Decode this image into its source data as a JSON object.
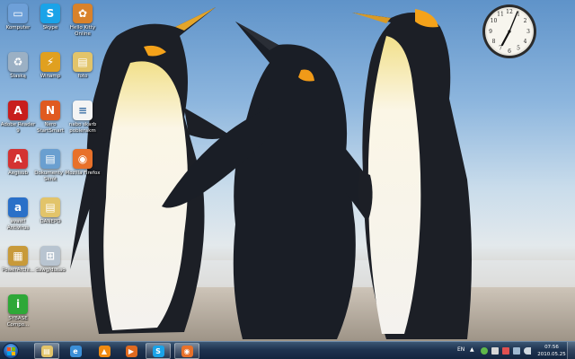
{
  "desktop": {
    "icons": [
      {
        "label": "Komputer",
        "icon": "computer-icon",
        "color": "#6ea0d8"
      },
      {
        "label": "Skype",
        "icon": "skype-icon",
        "color": "#1aa3e8"
      },
      {
        "label": "Hello Kitty Online",
        "icon": "hello-kitty-icon",
        "color": "#d9822b"
      },
      {
        "label": "Ślaską",
        "icon": "recycle-bin-icon",
        "color": "#9bb0c4"
      },
      {
        "label": "Winamp",
        "icon": "winamp-icon",
        "color": "#e0a020"
      },
      {
        "label": "foto",
        "icon": "folder-icon",
        "color": "#e2c46a"
      },
      {
        "label": "Adobe Reader 9",
        "icon": "adobe-reader-icon",
        "color": "#c81d1d"
      },
      {
        "label": "Nero StartSmart",
        "icon": "nero-icon",
        "color": "#e05a20"
      },
      {
        "label": "nabo skarb pobierakm",
        "icon": "document-icon",
        "color": "#f4f4f4"
      },
      {
        "label": "Aegisub",
        "icon": "aegisub-icon",
        "color": "#d43232"
      },
      {
        "label": "Dokumenty - Skrót",
        "icon": "documents-shortcut-icon",
        "color": "#6a9fd0"
      },
      {
        "label": "Mozilla Firefox",
        "icon": "firefox-icon",
        "color": "#e8712a"
      },
      {
        "label": "avast! Antivirus",
        "icon": "avast-icon",
        "color": "#2a70c8"
      },
      {
        "label": "DANEPD",
        "icon": "folder-icon",
        "color": "#e2c46a"
      },
      {
        "label": "PowerArchi...",
        "icon": "archive-icon",
        "color": "#c89a3a"
      },
      {
        "label": "dawg/dusao",
        "icon": "network-icon",
        "color": "#b8c4d0"
      },
      {
        "label": "SYBASE Compo...",
        "icon": "info-icon",
        "color": "#2ea838"
      }
    ]
  },
  "taskbar": {
    "buttons": [
      {
        "name": "explorer",
        "icon": "folder-icon",
        "color": "#e2c46a",
        "active": true
      },
      {
        "name": "ie",
        "icon": "ie-icon",
        "color": "#3b8fd8",
        "active": false
      },
      {
        "name": "vlc",
        "icon": "vlc-icon",
        "color": "#f08a10",
        "active": false
      },
      {
        "name": "media-player",
        "icon": "media-player-icon",
        "color": "#e06a20",
        "active": false
      },
      {
        "name": "skype",
        "icon": "skype-icon",
        "color": "#1aa3e8",
        "active": true
      },
      {
        "name": "firefox",
        "icon": "firefox-icon",
        "color": "#e8712a",
        "active": true
      }
    ],
    "tray": {
      "language": "EN",
      "time": "07:56",
      "date": "2010.05.25"
    }
  },
  "colors": {
    "taskbar": "#1e3350",
    "sky": "#8db6de"
  }
}
